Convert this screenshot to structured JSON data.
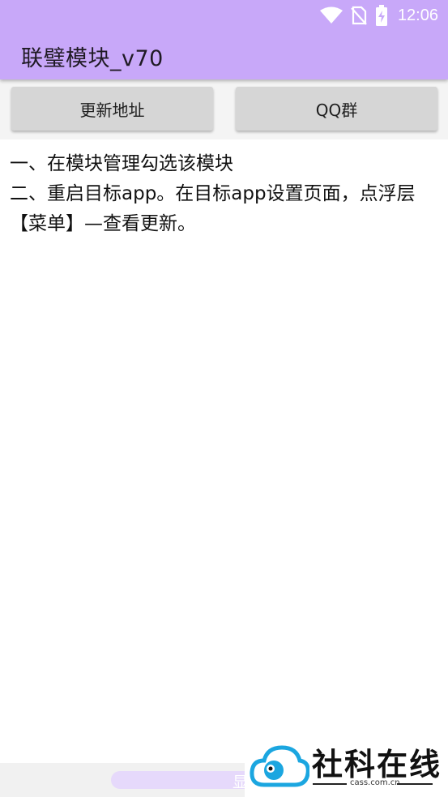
{
  "status_bar": {
    "time": "12:06",
    "icons": [
      "wifi-icon",
      "no-sim-icon",
      "battery-charging-icon"
    ]
  },
  "app_bar": {
    "title": "联璧模块_v70"
  },
  "buttons": {
    "update_address": "更新地址",
    "qq_group": "QQ群"
  },
  "instructions": [
    "一、在模块管理勾选该模块",
    "二、重启目标app。在目标app设置页面，点浮层【菜单】—查看更新。"
  ],
  "bottom": {
    "partial_label": "显"
  },
  "watermark": {
    "text": "社科在线",
    "domain": "cass.com.cn",
    "colors": {
      "cloud": "#1ba6e0",
      "text": "#111111"
    }
  },
  "colors": {
    "app_bar": "#c8a8f9",
    "button": "#d6d6d6"
  }
}
